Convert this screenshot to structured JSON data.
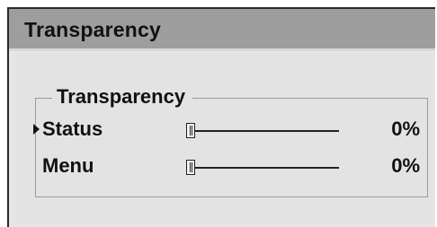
{
  "window": {
    "title": "Transparency"
  },
  "group": {
    "legend": "Transparency"
  },
  "rows": [
    {
      "label": "Status",
      "value": "0%",
      "level_percent": 0,
      "selected": true
    },
    {
      "label": "Menu",
      "value": "0%",
      "level_percent": 0,
      "selected": false
    }
  ],
  "icons": {
    "cursor": "selection-arrow-icon"
  },
  "colors": {
    "title_bar": "#9e9e9e",
    "panel": "#e3e3e3",
    "text": "#111111"
  }
}
